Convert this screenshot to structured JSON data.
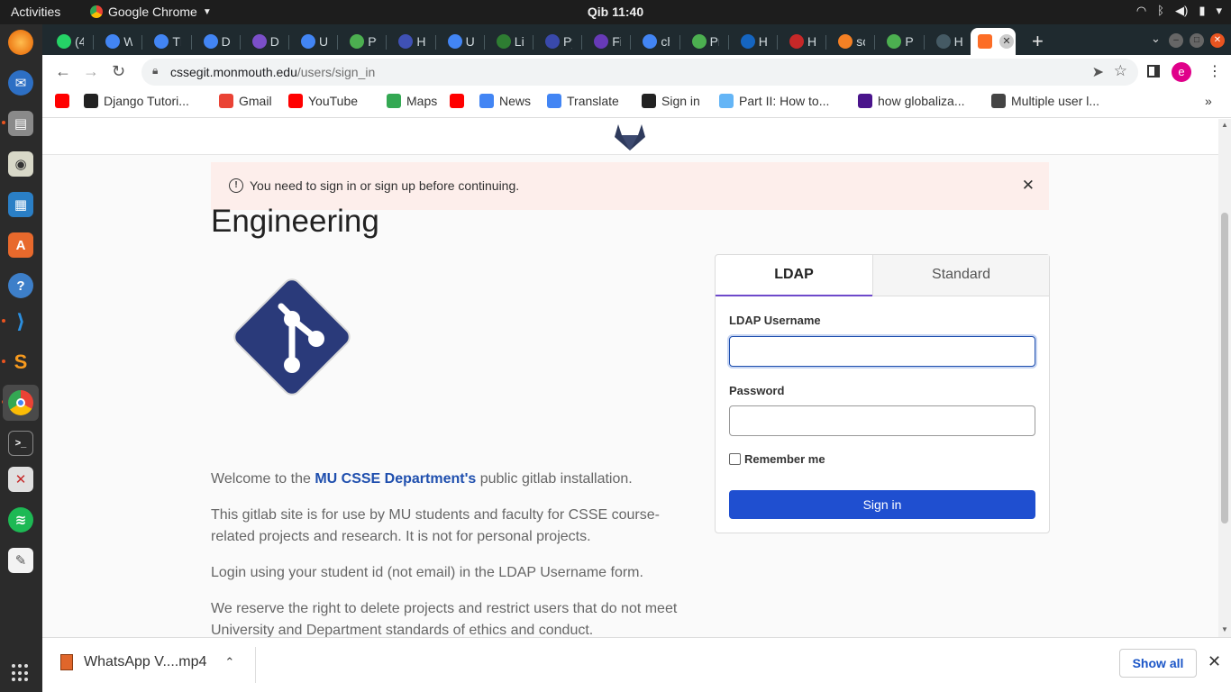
{
  "os": {
    "activities": "Activities",
    "app_name": "Google Chrome",
    "clock": "Qib 11:40"
  },
  "tabs": [
    {
      "label": "(4",
      "favicon": "whatsapp-icon",
      "color": "#25d366"
    },
    {
      "label": "W",
      "favicon": "google-icon",
      "color": "#4285f4"
    },
    {
      "label": "Th",
      "favicon": "google-icon",
      "color": "#4285f4"
    },
    {
      "label": "De",
      "favicon": "google-icon",
      "color": "#4285f4"
    },
    {
      "label": "De",
      "favicon": "visual-studio-icon",
      "color": "#7b4fc9"
    },
    {
      "label": "Us",
      "favicon": "google-icon",
      "color": "#4285f4"
    },
    {
      "label": "Py",
      "favicon": "link-icon",
      "color": "#4caf50"
    },
    {
      "label": "Hc",
      "favicon": "site-icon",
      "color": "#3f51b5"
    },
    {
      "label": "Us",
      "favicon": "google-icon",
      "color": "#4285f4"
    },
    {
      "label": "Li",
      "favicon": "site-icon",
      "color": "#2e7d32"
    },
    {
      "label": "Py",
      "favicon": "site-icon",
      "color": "#3949ab"
    },
    {
      "label": "Fi",
      "favicon": "site-icon",
      "color": "#673ab7"
    },
    {
      "label": "ch",
      "favicon": "google-icon",
      "color": "#4285f4"
    },
    {
      "label": "Pr",
      "favicon": "link-icon",
      "color": "#4caf50"
    },
    {
      "label": "Hc",
      "favicon": "edge-icon",
      "color": "#1565c0"
    },
    {
      "label": "Hc",
      "favicon": "site-icon",
      "color": "#c62828"
    },
    {
      "label": "sc",
      "favicon": "stackoverflow-icon",
      "color": "#f48024"
    },
    {
      "label": "Py",
      "favicon": "link-icon",
      "color": "#4caf50"
    },
    {
      "label": "Hc",
      "favicon": "site-icon",
      "color": "#455a64"
    }
  ],
  "active_tab": {
    "favicon": "gitlab-icon",
    "color": "#fc6d26"
  },
  "address_bar": {
    "host": "cssegit.monmouth.edu",
    "path": "/users/sign_in"
  },
  "profile_initial": "e",
  "bookmarks": [
    {
      "label": "",
      "icon": "youtube-icon",
      "color": "#ff0000"
    },
    {
      "label": "Django Tutori...",
      "icon": "django-icon",
      "color": "#222222"
    },
    {
      "label": "Gmail",
      "icon": "gmail-icon",
      "color": "#ea4335"
    },
    {
      "label": "YouTube",
      "icon": "youtube-icon",
      "color": "#ff0000"
    },
    {
      "label": "Maps",
      "icon": "maps-icon",
      "color": "#34a853"
    },
    {
      "label": "",
      "icon": "youtube-icon",
      "color": "#ff0000"
    },
    {
      "label": "News",
      "icon": "news-icon",
      "color": "#4285f4"
    },
    {
      "label": "Translate",
      "icon": "translate-icon",
      "color": "#4285f4"
    },
    {
      "label": "Sign in",
      "icon": "github-icon",
      "color": "#222222"
    },
    {
      "label": "Part II: How to...",
      "icon": "site-icon",
      "color": "#64b5f6"
    },
    {
      "label": "how globaliza...",
      "icon": "site-icon",
      "color": "#4a148c"
    },
    {
      "label": "Multiple user l...",
      "icon": "site-icon",
      "color": "#444444"
    }
  ],
  "page": {
    "flash_message": "You need to sign in or sign up before continuing.",
    "title": "Engineering",
    "desc1_pre": "Welcome to the ",
    "desc1_bold": "MU CSSE Department's",
    "desc1_post": " public gitlab installation.",
    "desc2": "This gitlab site is for use by MU students and faculty for CSSE course-related projects and research. It is not for personal projects.",
    "desc3": "Login using your student id (not email) in the LDAP Username form.",
    "desc4": "We reserve the right to delete projects and restrict users that do not meet University and Department standards of ethics and conduct."
  },
  "login": {
    "tab_ldap": "LDAP",
    "tab_standard": "Standard",
    "username_label": "LDAP Username",
    "username_value": "",
    "password_label": "Password",
    "password_value": "",
    "remember_label": "Remember me",
    "remember_checked": false,
    "signin_button": "Sign in"
  },
  "downloads": {
    "file_name": "WhatsApp V....mp4",
    "show_all": "Show all"
  },
  "colors": {
    "brand_logo": "#2a3a7a",
    "primary_button": "#1f4fd0",
    "active_tab_underline": "#6e49cb",
    "flash_bg": "#fdeeeb"
  }
}
